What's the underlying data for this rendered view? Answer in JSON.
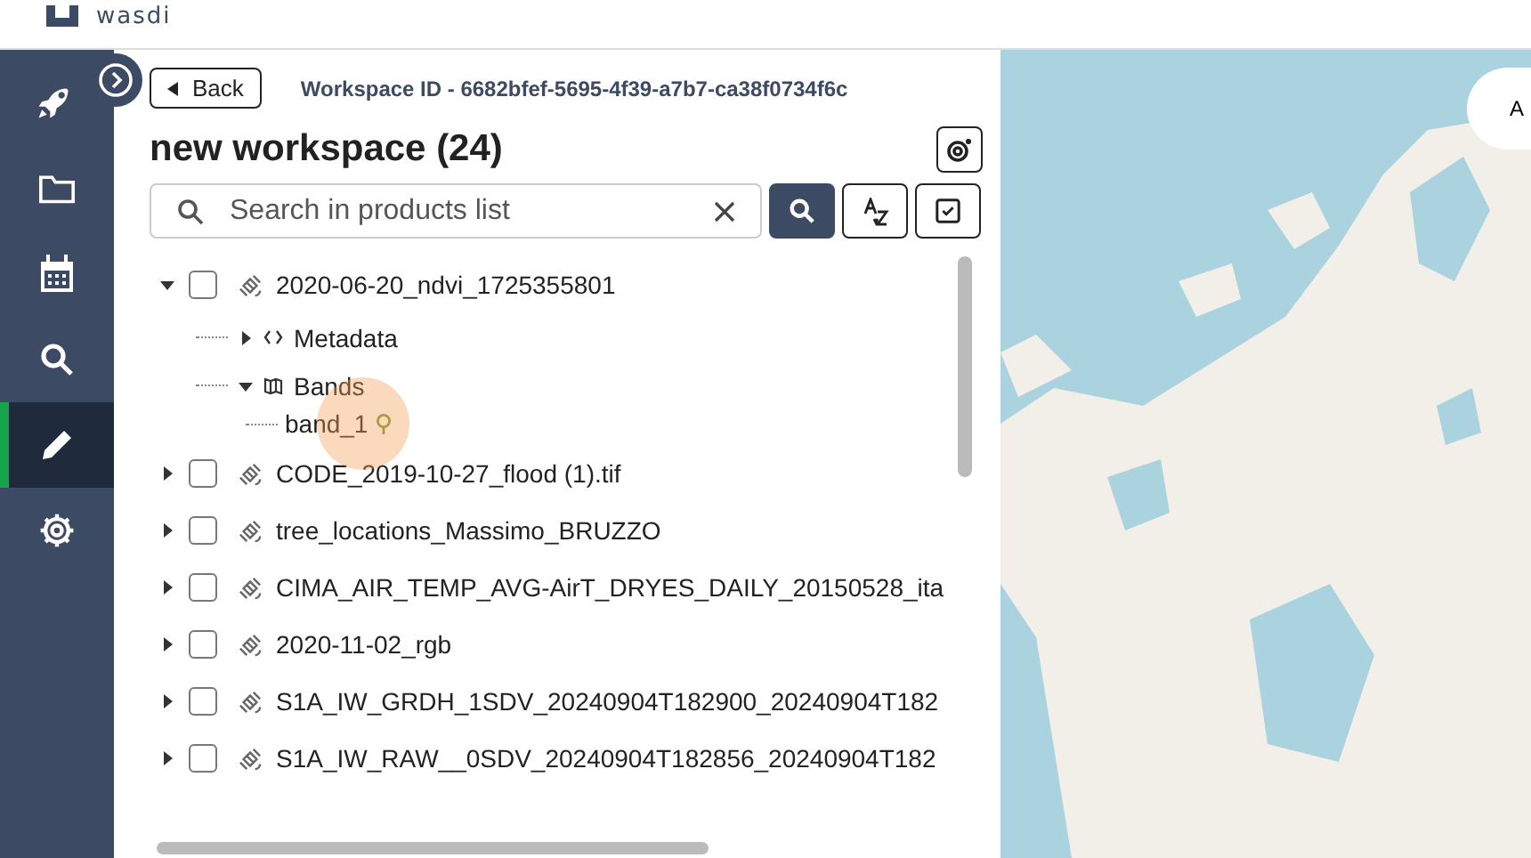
{
  "header": {
    "logo": "wasdi"
  },
  "sidebar": {
    "items": [
      {
        "selected": false
      },
      {
        "selected": false
      },
      {
        "selected": false
      },
      {
        "selected": false
      },
      {
        "selected": true
      },
      {
        "selected": false
      }
    ]
  },
  "panel": {
    "back_button": "Back",
    "workspace_id": "Workspace ID - 6682bfef-5695-4f39-a7b7-ca38f0734f6c",
    "title": "new workspace (24)",
    "search": {
      "placeholder": "Search in products list"
    },
    "products": [
      {
        "name": "2020-06-20_ndvi_1725355801",
        "expanded": true,
        "checked": false,
        "children": [
          {
            "kind": "metadata",
            "name": "Metadata",
            "expanded": false
          },
          {
            "kind": "bands",
            "name": "Bands",
            "expanded": true,
            "children": [
              {
                "name": "band_1",
                "highlighted": true
              }
            ]
          }
        ]
      },
      {
        "name": "CODE_2019-10-27_flood (1).tif",
        "expanded": false,
        "checked": false
      },
      {
        "name": "tree_locations_Massimo_BRUZZO",
        "expanded": false,
        "checked": false
      },
      {
        "name": "CIMA_AIR_TEMP_AVG-AirT_DRYES_DAILY_20150528_ita",
        "expanded": false,
        "checked": false
      },
      {
        "name": "2020-11-02_rgb",
        "expanded": false,
        "checked": false
      },
      {
        "name": "S1A_IW_GRDH_1SDV_20240904T182900_20240904T182",
        "expanded": false,
        "checked": false
      },
      {
        "name": "S1A_IW_RAW__0SDV_20240904T182856_20240904T182",
        "expanded": false,
        "checked": false
      }
    ]
  },
  "map": {
    "kind": "picture",
    "overlay_button": "A"
  }
}
